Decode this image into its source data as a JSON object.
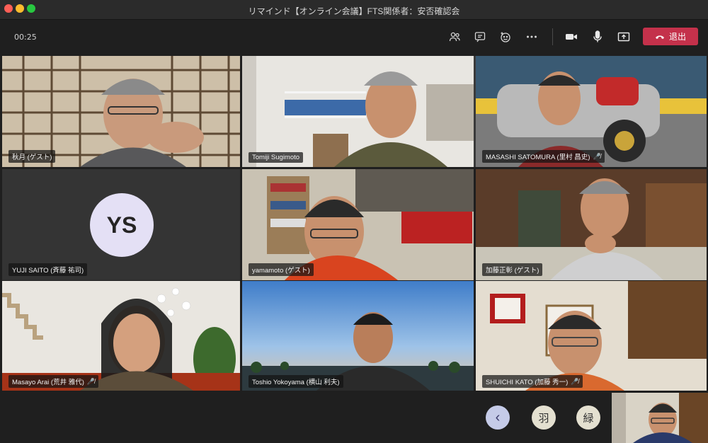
{
  "window": {
    "title": "リマインド【オンライン会議】FTS関係者：安否確認会"
  },
  "toolbar": {
    "timer": "00:25",
    "icons": [
      "participants-icon",
      "chat-icon",
      "reactions-icon",
      "more-icon",
      "camera-icon",
      "mic-icon",
      "share-icon"
    ],
    "leave_label": "退出"
  },
  "tiles": [
    {
      "name": "秋月 (ゲスト)",
      "muted": false
    },
    {
      "name": "Tomiji Sugimoto",
      "muted": false
    },
    {
      "name": "MASASHI SATOMURA (里村 昌史)",
      "muted": true
    },
    {
      "name": "YUJI SAITO (斉藤 祐司)",
      "muted": false,
      "initials": "YS"
    },
    {
      "name": "yamamoto (ゲスト)",
      "muted": false
    },
    {
      "name": "加藤正彰 (ゲスト)",
      "muted": false
    },
    {
      "name": "Masayo Arai (荒井 雅代)",
      "muted": true
    },
    {
      "name": "Toshio Yokoyama (横山 利夫)",
      "muted": false
    },
    {
      "name": "SHUICHI KATO (加藤 秀一)",
      "muted": true
    }
  ],
  "bottom_bar": {
    "prev_label": "‹",
    "avatar_a": "羽",
    "avatar_b": "緑"
  },
  "colors": {
    "leave": "#c4314b",
    "avatar_bg": "#e4e0f5",
    "background": "#1f1f1f"
  }
}
